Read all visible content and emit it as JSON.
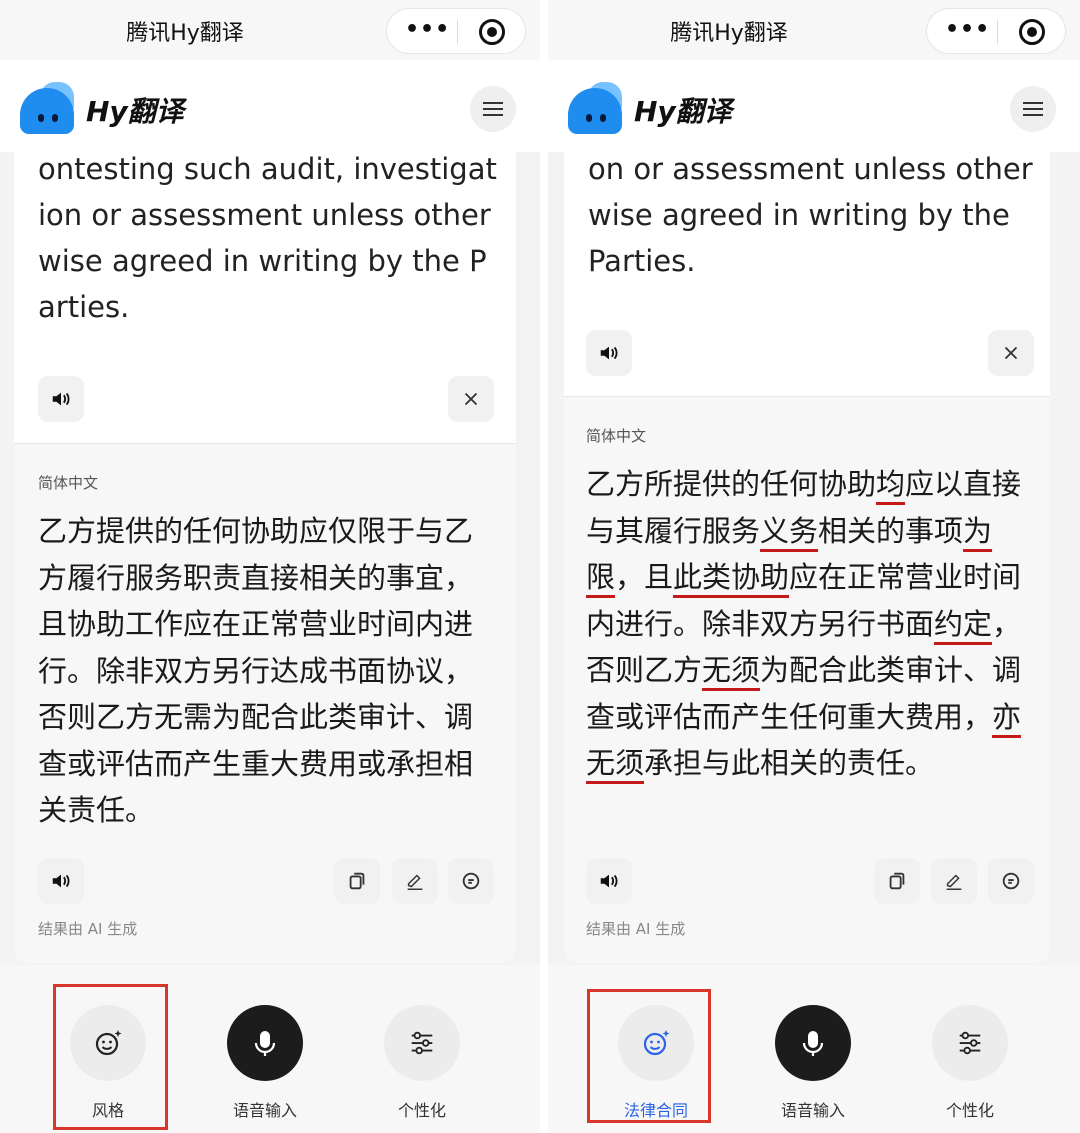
{
  "colors": {
    "accent": "#2a63e8",
    "annotation": "#d9362b",
    "underline": "#c41a1a"
  },
  "left": {
    "topbar_title": "腾讯Hy翻译",
    "brand": "Hy翻译",
    "source_text": "ontesting such audit, investigation or assessment unless otherwise agreed in writing by the Parties.",
    "target_lang": "简体中文",
    "target_text": "乙方提供的任何协助应仅限于与乙方履行服务职责直接相关的事宜，且协助工作应在正常营业时间内进行。除非双方另行达成书面协议，否则乙方无需为配合此类审计、调查或评估而产生重大费用或承担相关责任。",
    "ai_note": "结果由 AI 生成",
    "tools": {
      "style": "风格",
      "voice": "语音输入",
      "personal": "个性化"
    }
  },
  "right": {
    "topbar_title": "腾讯Hy翻译",
    "brand": "Hy翻译",
    "source_text": "on or assessment unless otherwise agreed in writing by the Parties.",
    "target_lang": "简体中文",
    "target_segments": [
      {
        "t": "乙方所提供的任何协助",
        "u": false
      },
      {
        "t": "均",
        "u": true
      },
      {
        "t": "应以直接与其履行服务",
        "u": false
      },
      {
        "t": "义务",
        "u": true
      },
      {
        "t": "相关的事项",
        "u": false
      },
      {
        "t": "为限",
        "u": true
      },
      {
        "t": "，且",
        "u": false
      },
      {
        "t": "此类协助",
        "u": true
      },
      {
        "t": "应在正常营业时间内进行。除非双方另行书面",
        "u": false
      },
      {
        "t": "约定",
        "u": true
      },
      {
        "t": "，否则乙方",
        "u": false
      },
      {
        "t": "无须",
        "u": true
      },
      {
        "t": "为配合此类审计、调查或评估而产生任何重大费用，",
        "u": false
      },
      {
        "t": "亦无须",
        "u": true
      },
      {
        "t": "承担与此相关的责任。",
        "u": false
      }
    ],
    "ai_note": "结果由 AI 生成",
    "tools": {
      "style": "法律合同",
      "voice": "语音输入",
      "personal": "个性化"
    }
  },
  "icons": [
    "more-dots-icon",
    "target-icon",
    "menu-icon",
    "speaker-icon",
    "close-icon",
    "copy-icon",
    "edit-icon",
    "feedback-icon",
    "smile-sparkle-icon",
    "microphone-icon",
    "sliders-icon"
  ]
}
